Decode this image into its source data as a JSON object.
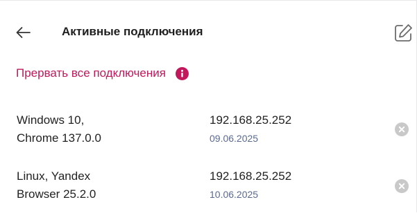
{
  "header": {
    "title": "Активные подключения",
    "back_icon": "arrow-left-icon",
    "edit_icon": "edit-icon"
  },
  "terminate_all": {
    "label": "Прервать все подключения",
    "icon": "info-icon"
  },
  "sessions": [
    {
      "device_line1": "Windows 10,",
      "device_line2": "Chrome 137.0.0",
      "ip": "192.168.25.252",
      "date": "09.06.2025",
      "close_icon": "close-icon"
    },
    {
      "device_line1": "Linux, Yandex",
      "device_line2": "Browser 25.2.0",
      "ip": "192.168.25.252",
      "date": "10.06.2025",
      "close_icon": "close-icon"
    }
  ],
  "colors": {
    "accent": "#c2185b",
    "date_text": "#5b6a90",
    "close_icon_bg": "#c9c9c9"
  }
}
